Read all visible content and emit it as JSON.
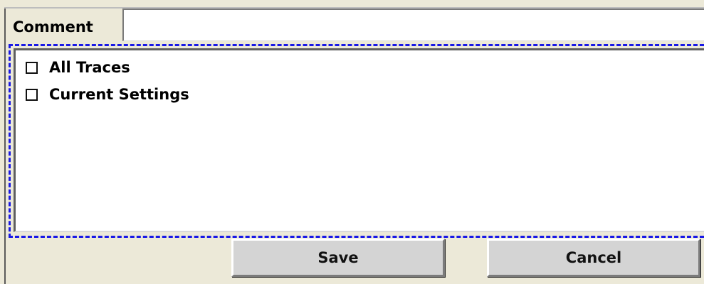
{
  "form": {
    "comment_label": "Comment",
    "comment_value": ""
  },
  "options": [
    {
      "label": "All Traces",
      "checked": false
    },
    {
      "label": "Current Settings",
      "checked": false
    }
  ],
  "buttons": {
    "save_label": "Save",
    "cancel_label": "Cancel"
  },
  "colors": {
    "panel_background": "#ece9d8",
    "focus_frame": "#1818e6",
    "button_face": "#d4d4d4"
  }
}
